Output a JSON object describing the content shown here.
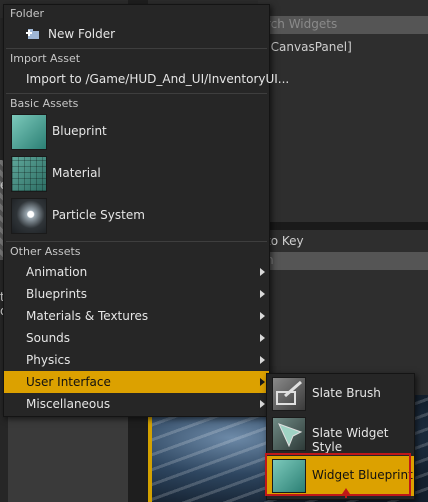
{
  "background": {
    "search_widgets_hint": "rch Widgets",
    "canvas_panel": "[CanvasPanel]",
    "to_key": "to Key",
    "search_hint_2": "h",
    "left_fragment_1": "e",
    "left_fragment_2": "te",
    "left_fragment_3": "dg"
  },
  "menu": {
    "folder_section": "Folder",
    "new_folder": "New Folder",
    "import_section": "Import Asset",
    "import_to": "Import to /Game/HUD_And_UI/InventoryUI...",
    "basic_section": "Basic Assets",
    "basic_assets": [
      {
        "label": "Blueprint",
        "icon": "blueprint-icon"
      },
      {
        "label": "Material",
        "icon": "material-icon"
      },
      {
        "label": "Particle System",
        "icon": "particle-system-icon"
      }
    ],
    "other_section": "Other Assets",
    "other_items": [
      {
        "label": "Animation",
        "selected": false
      },
      {
        "label": "Blueprints",
        "selected": false
      },
      {
        "label": "Materials & Textures",
        "selected": false
      },
      {
        "label": "Sounds",
        "selected": false
      },
      {
        "label": "Physics",
        "selected": false
      },
      {
        "label": "User Interface",
        "selected": true
      },
      {
        "label": "Miscellaneous",
        "selected": false
      }
    ]
  },
  "submenu": {
    "items": [
      {
        "label": "Slate Brush",
        "icon": "slate-brush-icon",
        "selected": false
      },
      {
        "label": "Slate Widget Style",
        "icon": "slate-widget-style-icon",
        "selected": false
      },
      {
        "label": "Widget Blueprint",
        "icon": "widget-blueprint-icon",
        "selected": true
      }
    ]
  },
  "colors": {
    "accent": "#dca100",
    "menu_bg": "#262626",
    "highlight_box": "#c01818"
  }
}
